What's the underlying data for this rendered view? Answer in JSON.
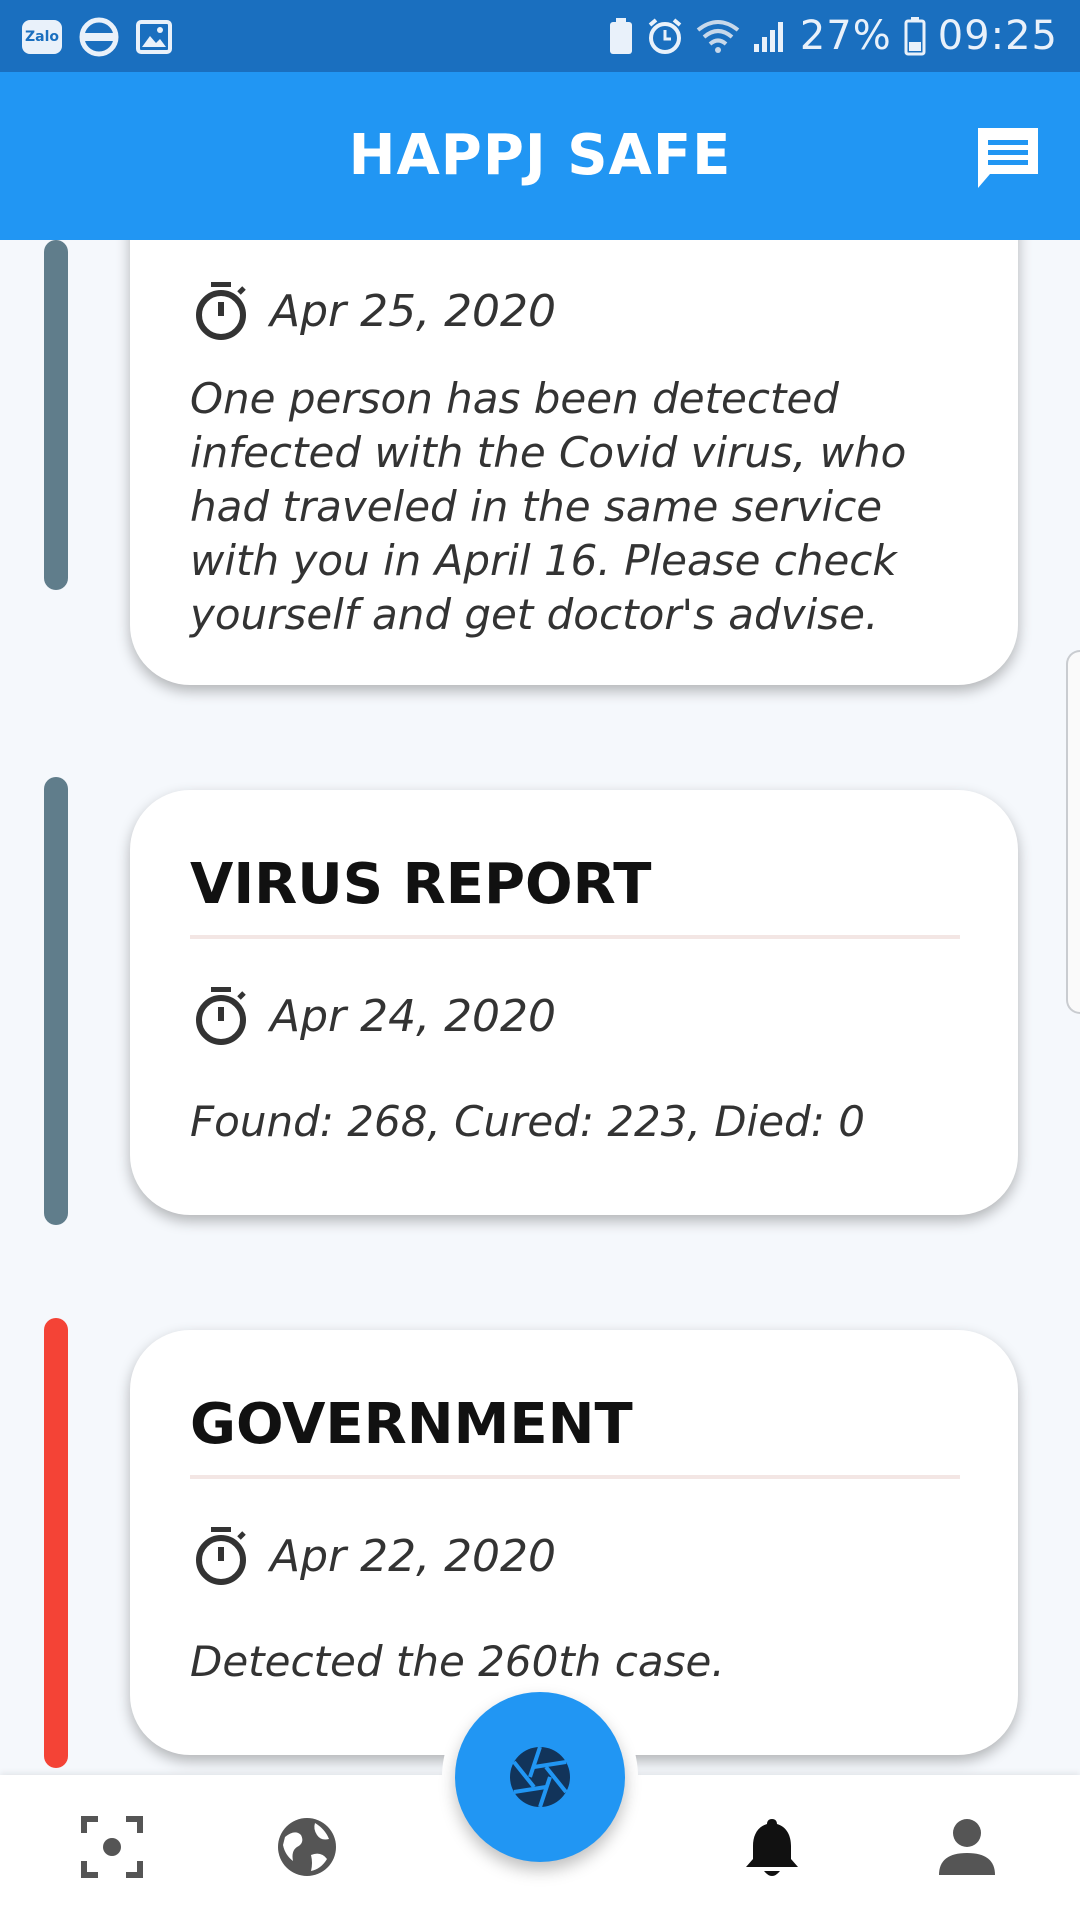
{
  "status_bar": {
    "app_badge": "Zalo",
    "battery": "27%",
    "time": "09:25"
  },
  "header": {
    "title": "HAPPJ SAFE"
  },
  "notifications": [
    {
      "title": "",
      "date": "Apr 25, 2020",
      "body": "One person has been detected infected with the Covid virus, who had traveled in the same service with you in April 16. Please check yourself and get doctor's advise.",
      "indicator_color": "#607d8b"
    },
    {
      "title": "VIRUS REPORT",
      "date": "Apr 24, 2020",
      "body": "Found: 268, Cured: 223, Died: 0",
      "indicator_color": "#607d8b"
    },
    {
      "title": "GOVERNMENT",
      "date": "Apr 22, 2020",
      "body": "Detected the 260th case.",
      "indicator_color": "#f44336"
    }
  ],
  "bottom_nav": {
    "items": [
      "scan-icon",
      "globe-icon",
      "camera-shutter-icon",
      "bell-icon",
      "person-icon"
    ],
    "active": "bell-icon"
  },
  "colors": {
    "primary": "#2196f3",
    "status_bar": "#1a6fbf",
    "neutral_indicator": "#607d8b",
    "alert_indicator": "#f44336"
  }
}
